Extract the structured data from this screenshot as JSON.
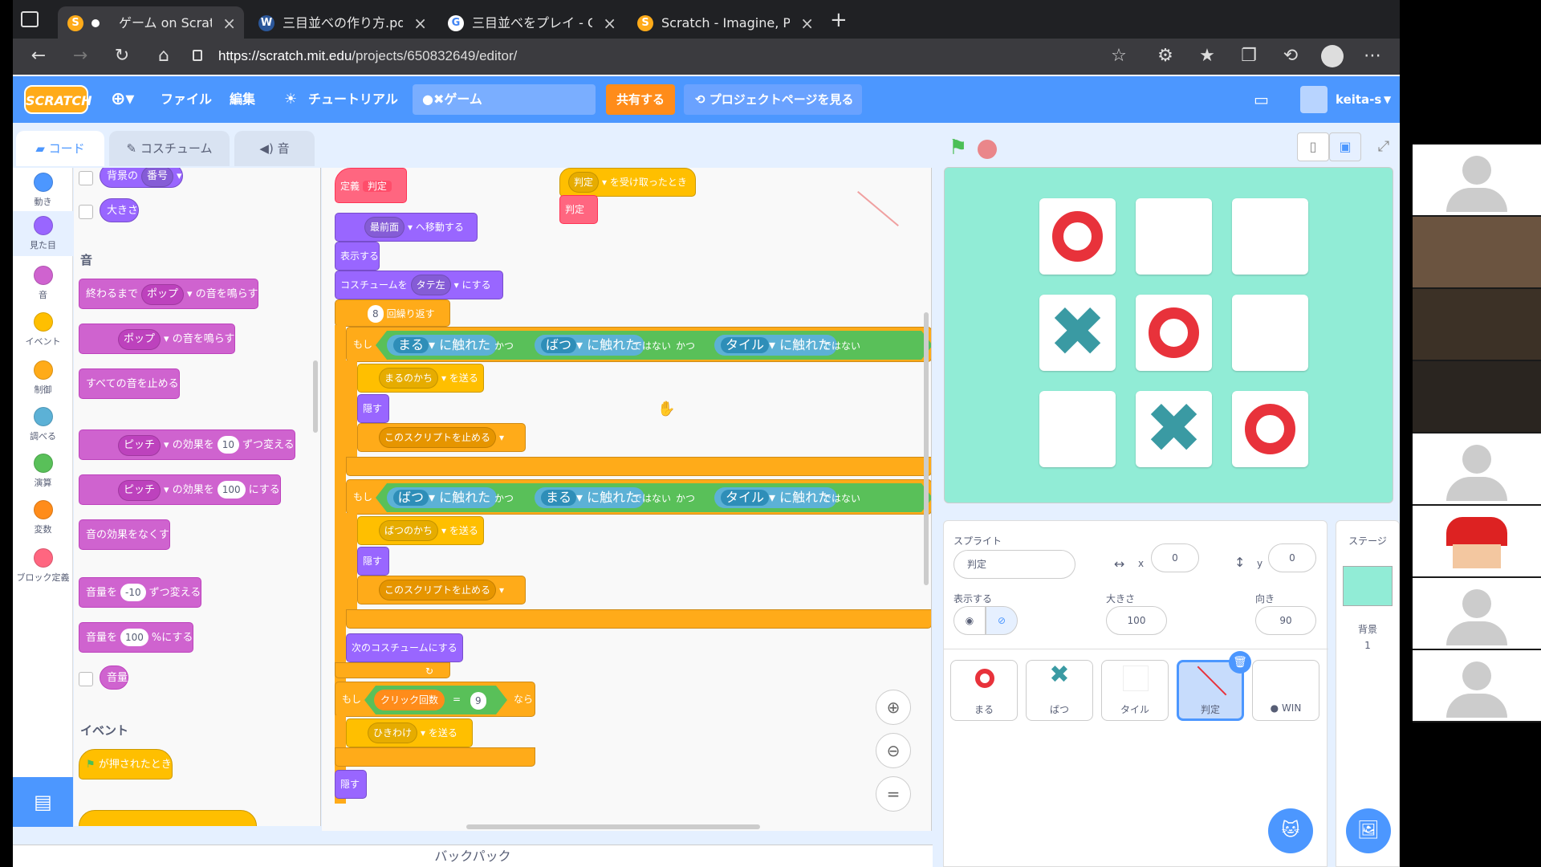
{
  "browser": {
    "tabs": [
      {
        "title": "ゲーム on Scratch",
        "active": true
      },
      {
        "title": "三目並べの作り方.pdf"
      },
      {
        "title": "三目並べをプレイ - Google 検索"
      },
      {
        "title": "Scratch - Imagine, Program, Sh"
      }
    ],
    "url_host": "https://scratch.mit.edu",
    "url_path": "/projects/650832649/editor/"
  },
  "menu": {
    "logo": "SCRATCH",
    "file": "ファイル",
    "edit": "編集",
    "tutorial": "チュートリアル",
    "project_title": "●✖ゲーム",
    "share": "共有する",
    "project_page": "プロジェクトページを見る",
    "user": "keita-s"
  },
  "editor_tabs": {
    "code": "コード",
    "costume": "コスチューム",
    "sound": "音"
  },
  "categories": [
    {
      "label": "動き",
      "color": "#4c97ff"
    },
    {
      "label": "見た目",
      "color": "#9966ff"
    },
    {
      "label": "音",
      "color": "#cf63cf"
    },
    {
      "label": "イベント",
      "color": "#ffbf00"
    },
    {
      "label": "制御",
      "color": "#ffab19"
    },
    {
      "label": "調べる",
      "color": "#5cb1d6"
    },
    {
      "label": "演算",
      "color": "#59c059"
    },
    {
      "label": "変数",
      "color": "#ff8c1a"
    },
    {
      "label": "ブロック定義",
      "color": "#ff6680"
    }
  ],
  "palette": {
    "backdrop_block": "背景の",
    "backdrop_dd": "番号",
    "size_block": "大きさ",
    "sound_header": "音",
    "play_until": "終わるまで",
    "pop": "ポップ",
    "play_until_tail": "の音を鳴らす",
    "start_sound_tail": "の音を鳴らす",
    "stop_all": "すべての音を止める",
    "pitch": "ピッチ",
    "change_effect": "の効果を",
    "change_val": "10",
    "change_tail": "ずつ変える",
    "set_effect": "の効果を",
    "set_val": "100",
    "set_tail": "にする",
    "clear_effects": "音の効果をなくす",
    "vol_change": "音量を",
    "vol_change_val": "-10",
    "vol_change_tail": "ずつ変える",
    "vol_set": "音量を",
    "vol_set_val": "100",
    "vol_set_tail": "%にする",
    "volume": "音量",
    "event_header": "イベント",
    "flag_clicked": "が押されたとき"
  },
  "script": {
    "define": "定義",
    "define_name": "判定",
    "receive_dd": "判定",
    "receive_tail": "を受け取ったとき",
    "judge_block": "判定",
    "goto_layer": "最前面",
    "goto_tail": "へ移動する",
    "show": "表示する",
    "costume_set": "コスチュームを",
    "costume_dd": "タテ左",
    "costume_tail": "にする",
    "repeat_n": "8",
    "repeat_tail": "回繰り返す",
    "if1": "もし",
    "and": "かつ",
    "touch_maru": "まる",
    "touch_batsu": "ばつ",
    "touch_tile": "タイル",
    "touching": "に触れた",
    "not": "ではない",
    "send_maru_win": "まるのかち",
    "send": "を送る",
    "hide": "隠す",
    "stop_this": "このスクリプトを止める",
    "send_batsu_win": "ばつのかち",
    "next_costume": "次のコスチュームにする",
    "click_count": "クリック回数",
    "eq": "=",
    "nine": "9",
    "then": "なら",
    "draw": "ひきわけ",
    "hide_final": "隠す"
  },
  "stage": {
    "bg_color": "#91ecd6",
    "board": [
      "O",
      "",
      "",
      "X",
      "O",
      "",
      "",
      "X",
      "O"
    ]
  },
  "sprite_info": {
    "label": "スプライト",
    "name": "判定",
    "x_label": "x",
    "x": "0",
    "y_label": "y",
    "y": "0",
    "show_label": "表示する",
    "size_label": "大きさ",
    "size": "100",
    "dir_label": "向き",
    "dir": "90"
  },
  "sprites": [
    {
      "name": "まる"
    },
    {
      "name": "ばつ"
    },
    {
      "name": "タイル"
    },
    {
      "name": "判定",
      "selected": true
    },
    {
      "name": "● WIN"
    }
  ],
  "stage_pane": {
    "label": "ステージ",
    "backdrop_label": "背景",
    "backdrop_count": "1"
  },
  "backpack": "バックパック"
}
